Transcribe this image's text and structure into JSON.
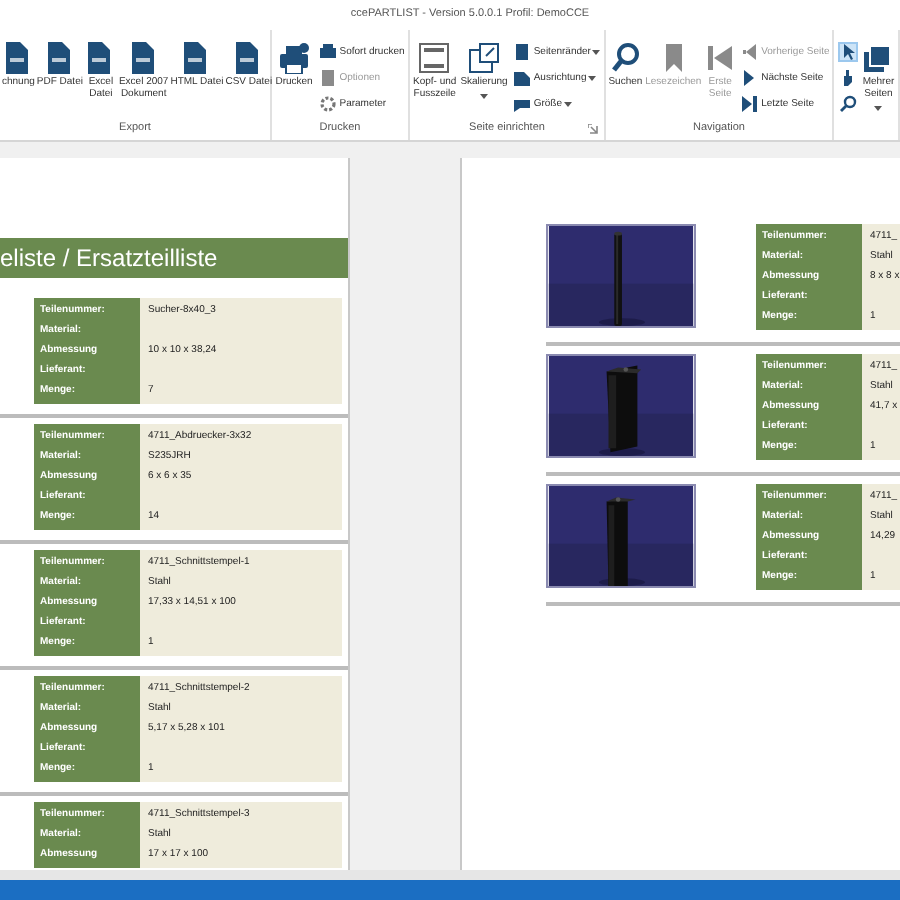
{
  "window": {
    "title": "ccePARTLIST - Version 5.0.0.1 Profil: DemoCCE"
  },
  "ribbon": {
    "groups": [
      {
        "label": "Export",
        "launcher": false,
        "items": [
          {
            "kind": "large",
            "label": "chnung",
            "disabled": false,
            "dropdown": false
          },
          {
            "kind": "large",
            "label": "PDF Datei",
            "disabled": false,
            "dropdown": false
          },
          {
            "kind": "large",
            "label": "Excel\nDatei",
            "disabled": false,
            "dropdown": false
          },
          {
            "kind": "large",
            "label": "Excel 2007\nDokument",
            "disabled": false,
            "dropdown": false
          },
          {
            "kind": "large",
            "label": "HTML Datei",
            "disabled": false,
            "dropdown": false
          },
          {
            "kind": "large",
            "label": "CSV Datei",
            "disabled": false,
            "dropdown": false
          }
        ]
      },
      {
        "label": "Drucken",
        "launcher": false,
        "items": [
          {
            "kind": "large",
            "label": "Drucken",
            "disabled": false,
            "dropdown": false
          },
          {
            "kind": "column",
            "entries": [
              {
                "label": "Sofort drucken",
                "disabled": false,
                "dropdown": false
              },
              {
                "label": "Optionen",
                "disabled": true,
                "dropdown": false
              },
              {
                "label": "Parameter",
                "disabled": false,
                "dropdown": false
              }
            ]
          }
        ]
      },
      {
        "label": "Seite einrichten",
        "launcher": true,
        "items": [
          {
            "kind": "large",
            "label": "Kopf- und\nFusszeile",
            "disabled": false,
            "dropdown": false
          },
          {
            "kind": "large",
            "label": "Skalierung",
            "disabled": false,
            "dropdown": true
          },
          {
            "kind": "column",
            "entries": [
              {
                "label": "Seitenränder",
                "disabled": false,
                "dropdown": true
              },
              {
                "label": "Ausrichtung",
                "disabled": false,
                "dropdown": true
              },
              {
                "label": "Größe",
                "disabled": false,
                "dropdown": true
              }
            ]
          }
        ]
      },
      {
        "label": "Navigation",
        "launcher": false,
        "items": [
          {
            "kind": "large",
            "label": "Suchen",
            "disabled": false,
            "dropdown": false
          },
          {
            "kind": "large",
            "label": "Lesezeichen",
            "disabled": true,
            "dropdown": false
          },
          {
            "kind": "large",
            "label": "Erste\nSeite",
            "disabled": true,
            "dropdown": false
          },
          {
            "kind": "column",
            "entries": [
              {
                "label": "Vorherige Seite",
                "disabled": true,
                "dropdown": false
              },
              {
                "label": "Nächste Seite",
                "disabled": false,
                "dropdown": false
              },
              {
                "label": "Letzte Seite",
                "disabled": false,
                "dropdown": false
              }
            ]
          }
        ]
      },
      {
        "launcher": false,
        "items": [
          {
            "kind": "tools",
            "entries": [
              {
                "selected": true
              },
              {
                "selected": false
              },
              {
                "selected": false
              }
            ]
          },
          {
            "kind": "large",
            "label": "Mehrer\nSeiten",
            "disabled": false,
            "dropdown": true
          }
        ]
      }
    ]
  },
  "pages": [
    {
      "heading": "eliste / Ersatzteilliste",
      "parts": [
        {
          "fields": [
            {
              "label": "Teilenummer:",
              "value": "Sucher-8x40_3"
            },
            {
              "label": "Material:"
            },
            {
              "label": "Abmessung",
              "value": "10 x 10 x 38,24"
            },
            {
              "label": "Lieferant:"
            },
            {
              "label": "Menge:",
              "value": "7"
            }
          ]
        },
        {
          "fields": [
            {
              "label": "Teilenummer:",
              "value": "4711_Abdruecker-3x32"
            },
            {
              "label": "Material:",
              "value": "S235JRH"
            },
            {
              "label": "Abmessung",
              "value": "6 x 6 x 35"
            },
            {
              "label": "Lieferant:"
            },
            {
              "label": "Menge:",
              "value": "14"
            }
          ]
        },
        {
          "fields": [
            {
              "label": "Teilenummer:",
              "value": "4711_Schnittstempel-1"
            },
            {
              "label": "Material:",
              "value": "Stahl"
            },
            {
              "label": "Abmessung",
              "value": "17,33 x 14,51 x 100"
            },
            {
              "label": "Lieferant:"
            },
            {
              "label": "Menge:",
              "value": "1"
            }
          ]
        },
        {
          "fields": [
            {
              "label": "Teilenummer:",
              "value": "4711_Schnittstempel-2"
            },
            {
              "label": "Material:",
              "value": "Stahl"
            },
            {
              "label": "Abmessung",
              "value": "5,17 x 5,28 x 101"
            },
            {
              "label": "Lieferant:"
            },
            {
              "label": "Menge:",
              "value": "1"
            }
          ]
        },
        {
          "fields": [
            {
              "label": "Teilenummer:",
              "value": "4711_Schnittstempel-3"
            },
            {
              "label": "Material:",
              "value": "Stahl"
            },
            {
              "label": "Abmessung",
              "value": "17 x 17 x 100"
            }
          ]
        }
      ]
    },
    {
      "parts": [
        {
          "image": {
            "kind": "picture"
          },
          "fields": [
            {
              "label": "Teilenummer:",
              "value": "4711_"
            },
            {
              "label": "Material:",
              "value": "Stahl"
            },
            {
              "label": "Abmessung",
              "value": "8 x 8 x"
            },
            {
              "label": "Lieferant:"
            },
            {
              "label": "Menge:",
              "value": "1"
            }
          ]
        },
        {
          "image": {
            "kind": "picture"
          },
          "fields": [
            {
              "label": "Teilenummer:",
              "value": "4711_"
            },
            {
              "label": "Material:",
              "value": "Stahl"
            },
            {
              "label": "Abmessung",
              "value": "41,7 x"
            },
            {
              "label": "Lieferant:"
            },
            {
              "label": "Menge:",
              "value": "1"
            }
          ]
        },
        {
          "image": {
            "kind": "picture"
          },
          "fields": [
            {
              "label": "Teilenummer:",
              "value": "4711_"
            },
            {
              "label": "Material:",
              "value": "Stahl"
            },
            {
              "label": "Abmessung",
              "value": "14,29"
            },
            {
              "label": "Lieferant:"
            },
            {
              "label": "Menge:",
              "value": "1"
            }
          ]
        }
      ]
    }
  ]
}
